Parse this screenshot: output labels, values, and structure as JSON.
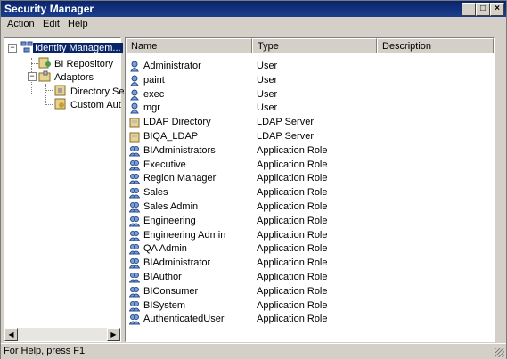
{
  "window": {
    "title": "Security Manager"
  },
  "menu": {
    "items": [
      {
        "label": "Action"
      },
      {
        "label": "Edit"
      },
      {
        "label": "Help"
      }
    ]
  },
  "tree": {
    "items": [
      {
        "label": "Identity Managem..."
      },
      {
        "label": "BI Repository"
      },
      {
        "label": "Adaptors"
      },
      {
        "label": "Directory Se"
      },
      {
        "label": "Custom Aut"
      }
    ],
    "expanders": [
      "−",
      "−"
    ]
  },
  "list": {
    "columns": [
      "Name",
      "Type",
      "Description"
    ],
    "rows": [
      {
        "name": "Administrator",
        "type": "User",
        "icon": "user-icon"
      },
      {
        "name": "paint",
        "type": "User",
        "icon": "user-icon"
      },
      {
        "name": "exec",
        "type": "User",
        "icon": "user-icon"
      },
      {
        "name": "mgr",
        "type": "User",
        "icon": "user-icon"
      },
      {
        "name": "LDAP Directory",
        "type": "LDAP Server",
        "icon": "ldap-server-icon"
      },
      {
        "name": "BIQA_LDAP",
        "type": "LDAP Server",
        "icon": "ldap-server-icon"
      },
      {
        "name": "BIAdministrators",
        "type": "Application Role",
        "icon": "role-icon"
      },
      {
        "name": "Executive",
        "type": "Application Role",
        "icon": "role-icon"
      },
      {
        "name": "Region Manager",
        "type": "Application Role",
        "icon": "role-icon"
      },
      {
        "name": "Sales",
        "type": "Application Role",
        "icon": "role-icon"
      },
      {
        "name": "Sales Admin",
        "type": "Application Role",
        "icon": "role-icon"
      },
      {
        "name": "Engineering",
        "type": "Application Role",
        "icon": "role-icon"
      },
      {
        "name": "Engineering Admin",
        "type": "Application Role",
        "icon": "role-icon"
      },
      {
        "name": "QA Admin",
        "type": "Application Role",
        "icon": "role-icon"
      },
      {
        "name": "BIAdministrator",
        "type": "Application Role",
        "icon": "role-icon"
      },
      {
        "name": "BIAuthor",
        "type": "Application Role",
        "icon": "role-icon"
      },
      {
        "name": "BIConsumer",
        "type": "Application Role",
        "icon": "role-icon"
      },
      {
        "name": "BISystem",
        "type": "Application Role",
        "icon": "role-icon"
      },
      {
        "name": "AuthenticatedUser",
        "type": "Application Role",
        "icon": "role-icon"
      }
    ]
  },
  "statusbar": {
    "text": "For Help, press F1"
  },
  "colors": {
    "selection": "#0a246a",
    "titlebar": "#0a246a",
    "chrome": "#d4d0c8"
  }
}
